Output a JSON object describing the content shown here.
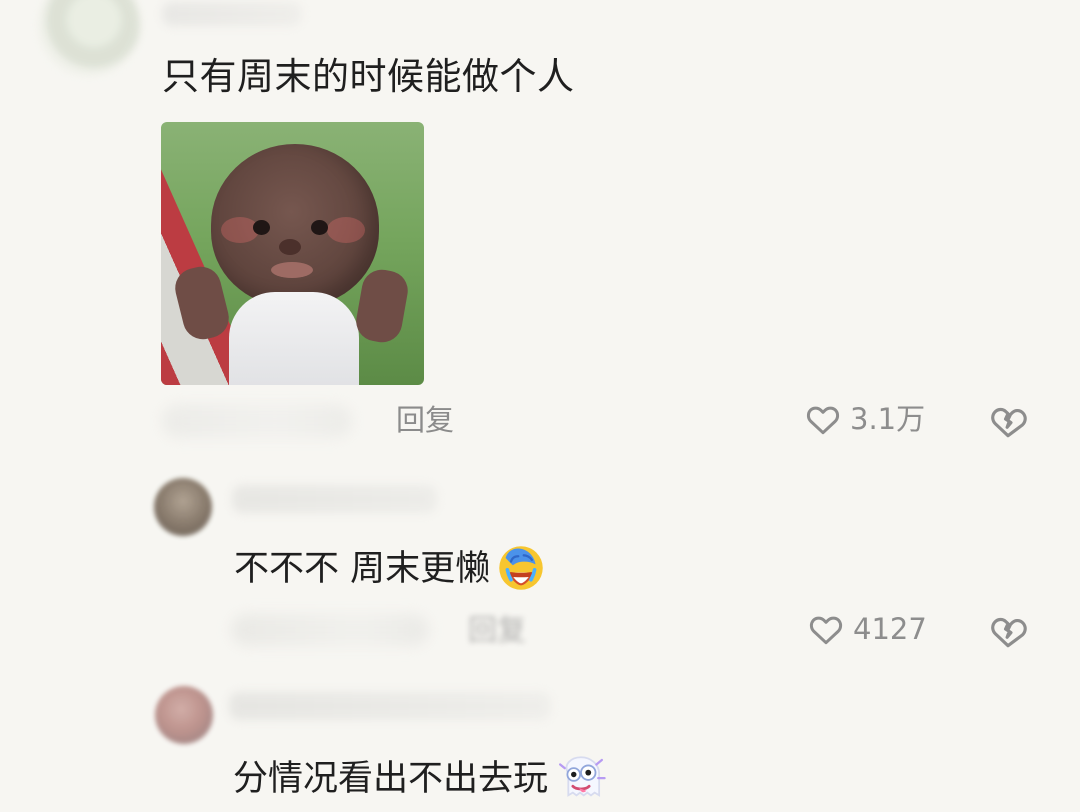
{
  "comments": [
    {
      "text": "只有周末的时候能做个人",
      "reply_label": "回复",
      "likes": "3.1万",
      "sticker_icon": "toddler-peace-sign-sticker"
    },
    {
      "text": "不不不 周末更懒",
      "reply_label": "回复",
      "likes": "4127",
      "emoji_icon": "facepalm-laughing-emoji"
    },
    {
      "text": "分情况看出不出去玩",
      "emoji_icon": "ghost-emoji"
    }
  ],
  "colors": {
    "background": "#f7f6f2",
    "text": "#1f1f1f",
    "muted": "#8b8b8b"
  },
  "icons": {
    "like": "heart-outline-icon",
    "dislike": "broken-heart-icon"
  }
}
